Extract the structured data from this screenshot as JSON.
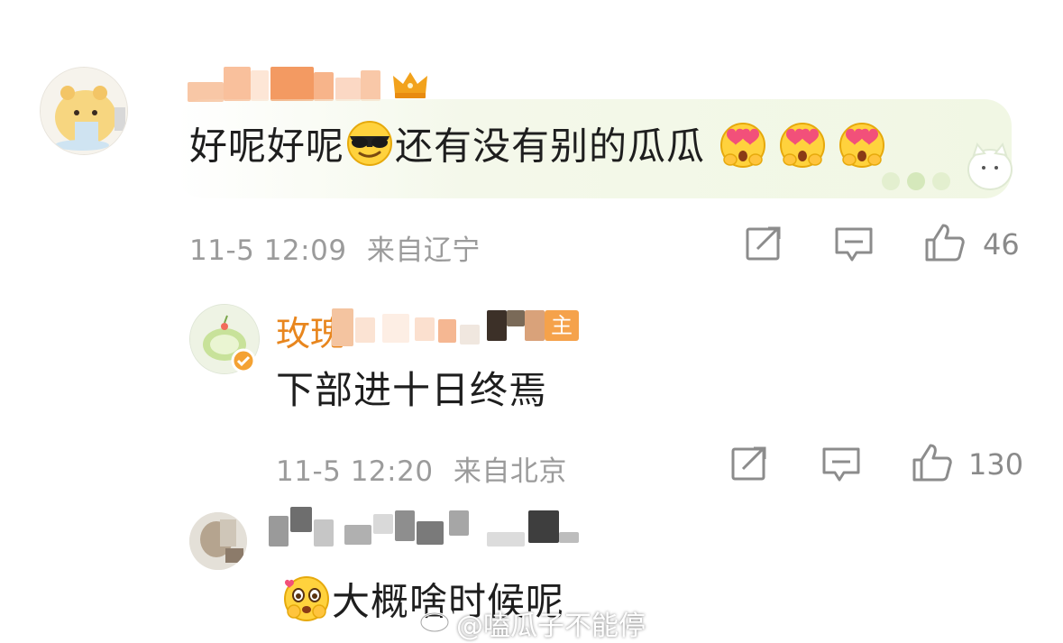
{
  "comments": [
    {
      "text_before_emoji": "好呢好呢",
      "emoji1": "sunglasses-emoji",
      "text_after_emoji": "还有没有别的瓜瓜",
      "reaction_emojis": [
        "heart-eyes-emoji",
        "heart-eyes-emoji",
        "heart-eyes-emoji"
      ],
      "time": "11-5 12:09",
      "location": "来自辽宁",
      "likes": "46"
    },
    {
      "username_visible": "玫瑰",
      "badge_char": "主",
      "text": "下部进十日终焉",
      "time": "11-5 12:20",
      "location": "来自北京",
      "likes": "130"
    },
    {
      "emoji": "pleading-emoji",
      "text": "大概啥时候呢"
    }
  ],
  "watermark": "@嗑瓜子不能停",
  "icons": {
    "share": "share-icon",
    "comment": "comment-icon",
    "like": "thumbs-up-icon",
    "crown": "crown-icon"
  },
  "colors": {
    "accent_orange": "#e8861e",
    "meta_gray": "#9b9b9b"
  }
}
